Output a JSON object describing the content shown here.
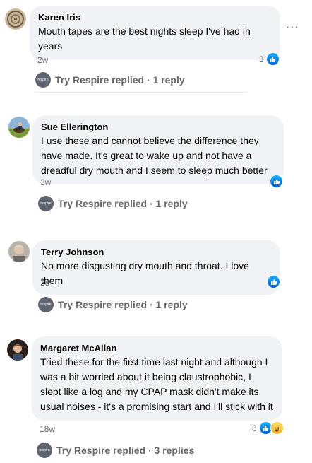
{
  "comments": [
    {
      "author": "Karen Iris",
      "text": "Mouth tapes are the best nights sleep I've had in years",
      "time": "2w",
      "reaction_count": "3",
      "reply_label": "Try Respire replied · 1 reply"
    },
    {
      "author": "Sue Ellerington",
      "text": "I use these and cannot believe the difference they have made. It's great to wake up and not have a dreadful dry mouth and I seem to sleep much better",
      "time": "3w",
      "reaction_count": "",
      "reply_label": "Try Respire replied · 1 reply"
    },
    {
      "author": "Terry Johnson",
      "text": "No more disgusting dry mouth and throat. I love them",
      "time": "2d",
      "reaction_count": "",
      "reply_label": "Try Respire replied · 1 reply"
    },
    {
      "author": "Margaret McAllan",
      "text": "Tried these for the first time last night and although I was a bit worried about it being claustrophobic, I slept like a log and my CPAP mask didn't make its usual noises - it's a promising start and I'll stick with it",
      "time": "18w",
      "reaction_count": "6",
      "reply_label": "Try Respire replied · 3 replies"
    }
  ],
  "reply_avatar_text": "respire",
  "more_options": "···",
  "icons": {
    "like": "like-reaction-icon",
    "haha": "haha-reaction-icon",
    "more": "more-options-icon"
  },
  "colors": {
    "bubble": "#f0f2f5",
    "secondary_text": "#65676b",
    "like_blue": "#0866ff"
  }
}
